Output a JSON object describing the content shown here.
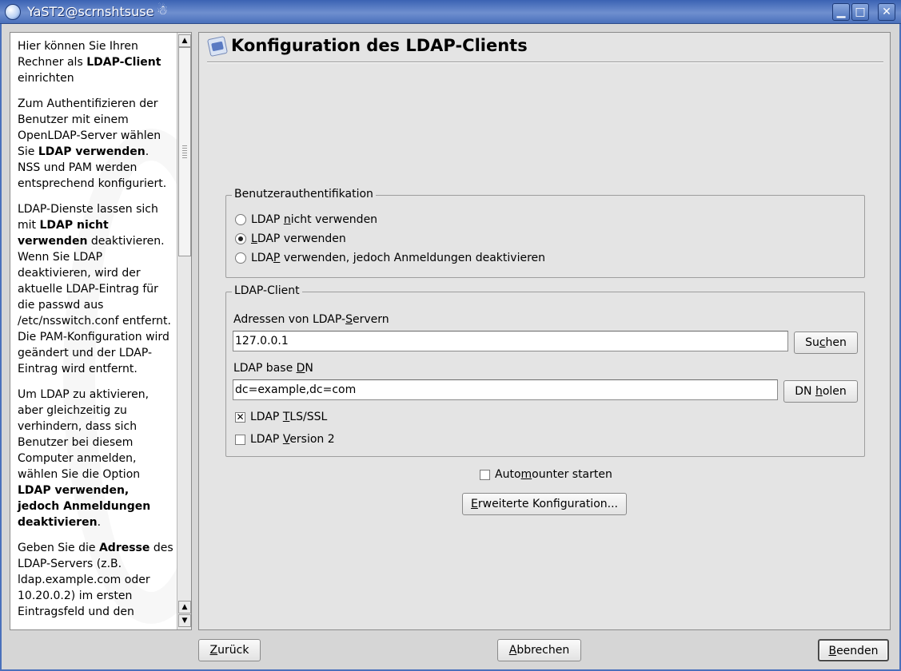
{
  "window": {
    "title": "YaST2@scrnshtsuse",
    "title_glyph": "☃",
    "icons": [
      "yast-icon",
      "minimize-icon",
      "maximize-icon",
      "close-icon"
    ],
    "minimize_glyph": "▁",
    "maximize_glyph": "□",
    "close_glyph": "✕"
  },
  "help": {
    "paragraphs": [
      [
        {
          "t": "Hier können Sie Ihren Rechner als "
        },
        {
          "t": "LDAP-Client",
          "b": true
        },
        {
          "t": " einrichten"
        }
      ],
      [
        {
          "t": "Zum Authentifizieren der Benutzer mit einem OpenLDAP-Server wählen Sie "
        },
        {
          "t": "LDAP verwenden",
          "b": true
        },
        {
          "t": ". NSS und PAM werden entsprechend konfiguriert."
        }
      ],
      [
        {
          "t": "LDAP-Dienste lassen sich mit "
        },
        {
          "t": "LDAP nicht verwenden",
          "b": true
        },
        {
          "t": " deaktivieren. Wenn Sie LDAP deaktivieren, wird der aktuelle LDAP-Eintrag für die passwd aus /etc/nsswitch.conf entfernt. Die PAM-Konfiguration wird geändert und der LDAP-Eintrag wird entfernt."
        }
      ],
      [
        {
          "t": "Um LDAP zu aktivieren, aber gleichzeitig zu verhindern, dass sich Benutzer bei diesem Computer anmelden, wählen Sie die Option "
        },
        {
          "t": "LDAP verwenden, jedoch Anmeldungen deaktivieren",
          "b": true
        },
        {
          "t": "."
        }
      ],
      [
        {
          "t": "Geben Sie die "
        },
        {
          "t": "Adresse",
          "b": true
        },
        {
          "t": " des LDAP-Servers (z.B. ldap.example.com oder 10.20.0.2) im ersten Eintragsfeld und den"
        }
      ]
    ],
    "scroll_up": "▲",
    "scroll_down": "▼"
  },
  "main": {
    "title": "Konfiguration des LDAP-Clients",
    "auth_group": {
      "title": "Benutzerauthentifikation",
      "options": [
        {
          "pre": "LDAP ",
          "acc": "n",
          "post": "icht verwenden",
          "selected": false
        },
        {
          "pre": "",
          "acc": "L",
          "post": "DAP verwenden",
          "selected": true
        },
        {
          "pre": "LDA",
          "acc": "P",
          "post": " verwenden, jedoch Anmeldungen deaktivieren",
          "selected": false
        }
      ]
    },
    "client_group": {
      "title": "LDAP-Client",
      "servers_label_pre": "Adressen von LDAP-",
      "servers_label_acc": "S",
      "servers_label_post": "ervern",
      "servers_value": "127.0.0.1",
      "search_pre": "Su",
      "search_acc": "c",
      "search_post": "hen",
      "basedn_label_pre": "LDAP base ",
      "basedn_label_acc": "D",
      "basedn_label_post": "N",
      "basedn_value": "dc=example,dc=com",
      "fetch_pre": "DN ",
      "fetch_acc": "h",
      "fetch_post": "olen",
      "tls_pre": "LDAP ",
      "tls_acc": "T",
      "tls_post": "LS/SSL",
      "tls_checked": true,
      "tls_mark": "✕",
      "v2_pre": "LDAP ",
      "v2_acc": "V",
      "v2_post": "ersion 2",
      "v2_checked": false
    },
    "automounter_pre": "Auto",
    "automounter_acc": "m",
    "automounter_post": "ounter starten",
    "automounter_checked": false,
    "advanced_acc": "E",
    "advanced_post": "rweiterte Konfiguration..."
  },
  "footer": {
    "back_acc": "Z",
    "back_post": "urück",
    "cancel_acc": "A",
    "cancel_post": "bbrechen",
    "finish_acc": "B",
    "finish_post": "eenden"
  }
}
